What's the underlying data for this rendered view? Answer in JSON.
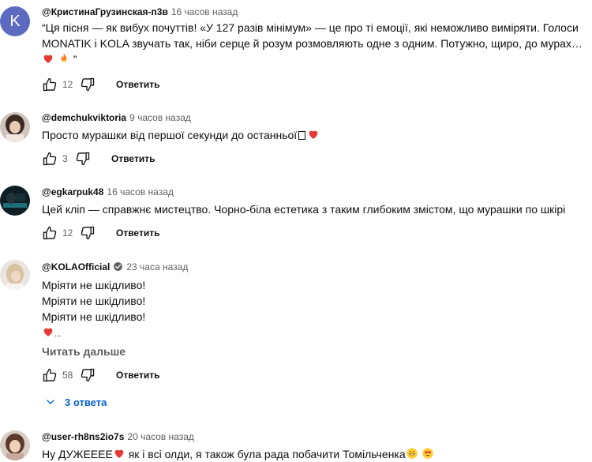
{
  "comments": [
    {
      "author": "@КристинаГрузинская-п3в",
      "time": "16 часов назад",
      "avatar_letter": "K",
      "avatar_color": "#5c6bc0",
      "line1": "“Ця пісня — як вибух почуттів! «У 127 разів мінімум» — це про ті емоції, які неможливо виміряти. Голоси",
      "line2": "MONATIK і KOLA звучать так, ніби серце й розум розмовляють одне з одним. Потужно, щиро, до мурах…",
      "line3_tail": " ”",
      "likes": "12",
      "reply_label": "Ответить"
    },
    {
      "author": "@demchukviktoria",
      "time": "9 часов назад",
      "text": "Просто мурашки від першої секунди до останньої",
      "likes": "3",
      "reply_label": "Ответить"
    },
    {
      "author": "@egkarpuk48",
      "time": "16 часов назад",
      "text": "Цей кліп — справжнє мистецтво. Чорно-біла естетика з таким глибоким змістом, що мурашки по шкірі",
      "likes": "12",
      "reply_label": "Ответить"
    },
    {
      "author": "@KOLAOfficial",
      "time": "23 часа назад",
      "line1": "Мріяти не шкідливо!",
      "line2": "Мріяти не шкідливо!",
      "line3": "Мріяти не шкідливо!",
      "line4_tail": "...",
      "read_more": "Читать дальше",
      "likes": "58",
      "reply_label": "Ответить",
      "replies_label": "3 ответа"
    },
    {
      "author": "@user-rh8ns2io7s",
      "time": "20 часов назад",
      "text_a": "Ну ДУЖЕЕЕЕ",
      "text_b": " як і всі олди, я також була рада побачити Томільченка"
    }
  ],
  "icons": {
    "like": "thumbs-up-icon",
    "dislike": "thumbs-down-icon",
    "heart": "heart-emoji",
    "fire": "fire-emoji",
    "verified": "verified-badge-icon",
    "chevron": "chevron-down-icon"
  },
  "colors": {
    "link_blue": "#065fd4",
    "muted": "#606060",
    "heart": "#e53935"
  }
}
